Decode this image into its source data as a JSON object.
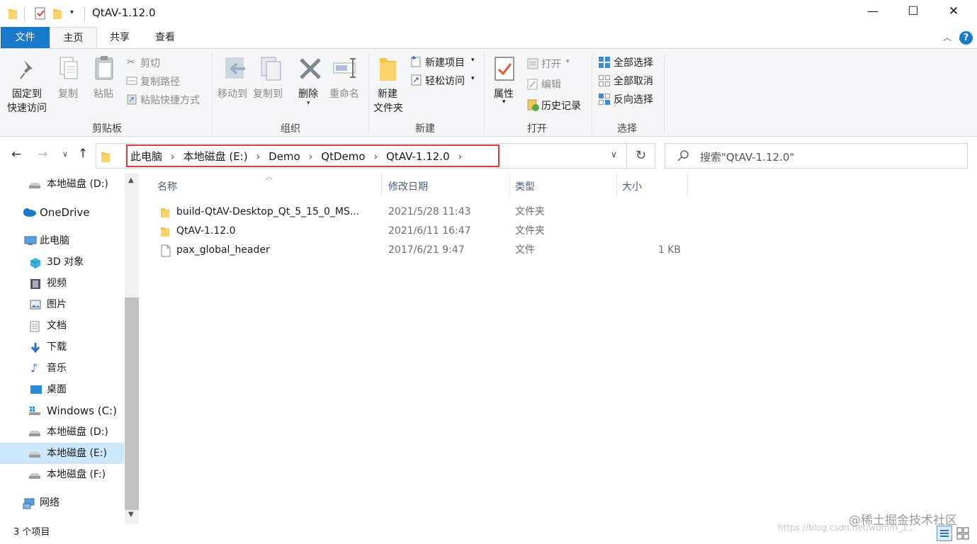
{
  "window": {
    "title": "QtAV-1.12.0",
    "controls": {
      "minimize": "—",
      "maximize": "☐",
      "close": "✕"
    }
  },
  "ribbon_tabs": {
    "file": "文件",
    "home": "主页",
    "share": "共享",
    "view": "查看"
  },
  "ribbon": {
    "clipboard": {
      "pin_line1": "固定到",
      "pin_line2": "快速访问",
      "copy": "复制",
      "paste": "粘贴",
      "cut": "剪切",
      "copy_path": "复制路径",
      "paste_shortcut": "粘贴快捷方式",
      "group": "剪贴板"
    },
    "organize": {
      "move_to": "移动到",
      "copy_to": "复制到",
      "delete": "删除",
      "rename": "重命名",
      "group": "组织"
    },
    "new": {
      "new_folder_line1": "新建",
      "new_folder_line2": "文件夹",
      "new_item": "新建项目",
      "easy_access": "轻松访问",
      "group": "新建"
    },
    "open": {
      "properties": "属性",
      "open": "打开",
      "edit": "编辑",
      "history": "历史记录",
      "group": "打开"
    },
    "select": {
      "select_all": "全部选择",
      "select_none": "全部取消",
      "invert": "反向选择",
      "group": "选择"
    }
  },
  "address": {
    "crumbs": [
      "此电脑",
      "本地磁盘 (E:)",
      "Demo",
      "QtDemo",
      "QtAV-1.12.0"
    ],
    "search_placeholder": "搜索\"QtAV-1.12.0\""
  },
  "sidebar": {
    "items": [
      {
        "label": "本地磁盘 (D:)",
        "icon": "drive-icon"
      },
      {
        "label": "OneDrive",
        "icon": "cloud-icon"
      },
      {
        "label": "此电脑",
        "icon": "computer-icon"
      },
      {
        "label": "3D 对象",
        "icon": "cube-icon"
      },
      {
        "label": "视频",
        "icon": "video-icon"
      },
      {
        "label": "图片",
        "icon": "picture-icon"
      },
      {
        "label": "文档",
        "icon": "document-icon"
      },
      {
        "label": "下载",
        "icon": "download-icon"
      },
      {
        "label": "音乐",
        "icon": "music-icon"
      },
      {
        "label": "桌面",
        "icon": "desktop-icon"
      },
      {
        "label": "Windows (C:)",
        "icon": "windows-drive-icon"
      },
      {
        "label": "本地磁盘 (D:)",
        "icon": "drive-icon"
      },
      {
        "label": "本地磁盘 (E:)",
        "icon": "drive-icon",
        "selected": true
      },
      {
        "label": "本地磁盘 (F:)",
        "icon": "drive-icon"
      },
      {
        "label": "网络",
        "icon": "network-icon"
      }
    ]
  },
  "columns": {
    "name": "名称",
    "modified": "修改日期",
    "type": "类型",
    "size": "大小"
  },
  "files": [
    {
      "name": "build-QtAV-Desktop_Qt_5_15_0_MS...",
      "modified": "2021/5/28 11:43",
      "type": "文件夹",
      "size": "",
      "icon": "folder-icon"
    },
    {
      "name": "QtAV-1.12.0",
      "modified": "2021/6/11 16:47",
      "type": "文件夹",
      "size": "",
      "icon": "folder-icon"
    },
    {
      "name": "pax_global_header",
      "modified": "2017/6/21 9:47",
      "type": "文件",
      "size": "1 KB",
      "icon": "file-icon"
    }
  ],
  "status": {
    "item_count": "3 个项目"
  },
  "watermark": "@稀土掘金技术社区",
  "watermark_url": "https://blog.csdn.net/wdmm_1...",
  "colors": {
    "accent": "#1979ca",
    "highlight": "#d93c3c",
    "selected_bg": "#cce8ff",
    "folder": "#f6c342"
  }
}
